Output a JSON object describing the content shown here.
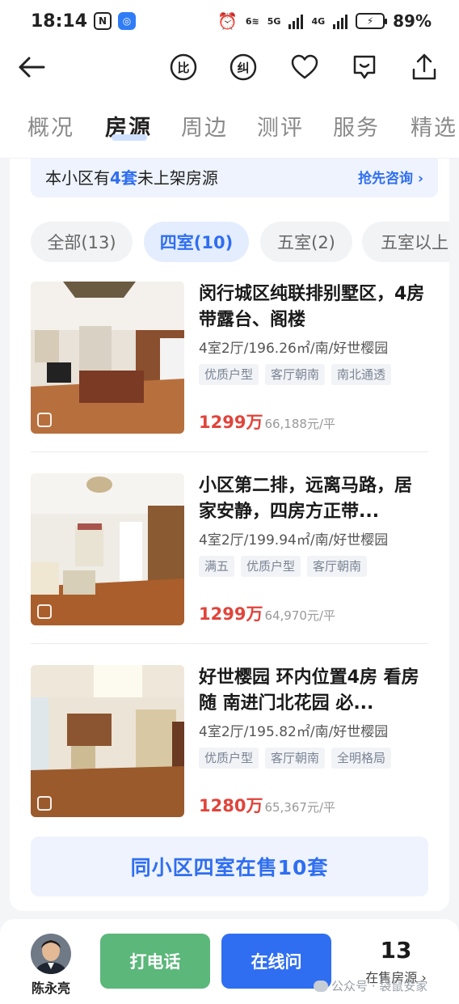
{
  "status_bar": {
    "time": "18:14",
    "nfc_icon_label": "N",
    "battery": "89%",
    "network": "5G",
    "network2": "4G",
    "network_prefix": "6"
  },
  "header": {
    "compare_icon_label": "比",
    "correct_icon_label": "纠"
  },
  "tabs": [
    "概况",
    "房源",
    "周边",
    "测评",
    "服务",
    "精选"
  ],
  "active_tab": "房源",
  "banner": {
    "prefix": "本小区有",
    "count": "4套",
    "suffix": "未上架房源",
    "cta": "抢先咨询 ›"
  },
  "filters": [
    {
      "label": "全部(13)",
      "active": false
    },
    {
      "label": "四室(10)",
      "active": true
    },
    {
      "label": "五室(2)",
      "active": false
    },
    {
      "label": "五室以上",
      "active": false
    }
  ],
  "listings": [
    {
      "title": "闵行城区纯联排别墅区，4房带露台、阁楼",
      "meta": "4室2厅/196.26㎡/南/好世樱园",
      "tags": [
        "优质户型",
        "客厅朝南",
        "南北通透"
      ],
      "price": "1299万",
      "unit_price": "66,188元/平"
    },
    {
      "title": "小区第二排，远离马路，居家安静，四房方正带...",
      "meta": "4室2厅/199.94㎡/南/好世樱园",
      "tags": [
        "满五",
        "优质户型",
        "客厅朝南"
      ],
      "price": "1299万",
      "unit_price": "64,970元/平"
    },
    {
      "title": "好世樱园 环内位置4房 看房随 南进门北花园 必...",
      "meta": "4室2厅/195.82㎡/南/好世樱园",
      "tags": [
        "优质户型",
        "客厅朝南",
        "全明格局"
      ],
      "price": "1280万",
      "unit_price": "65,367元/平"
    }
  ],
  "more_button": "同小区四室在售10套",
  "bottom_bar": {
    "agent_name": "陈永亮",
    "call_button": "打电话",
    "chat_button": "在线问",
    "onsale_count": "13",
    "onsale_label": "在售房源 ›"
  },
  "watermark": "公众号 · 袋鼠安家"
}
